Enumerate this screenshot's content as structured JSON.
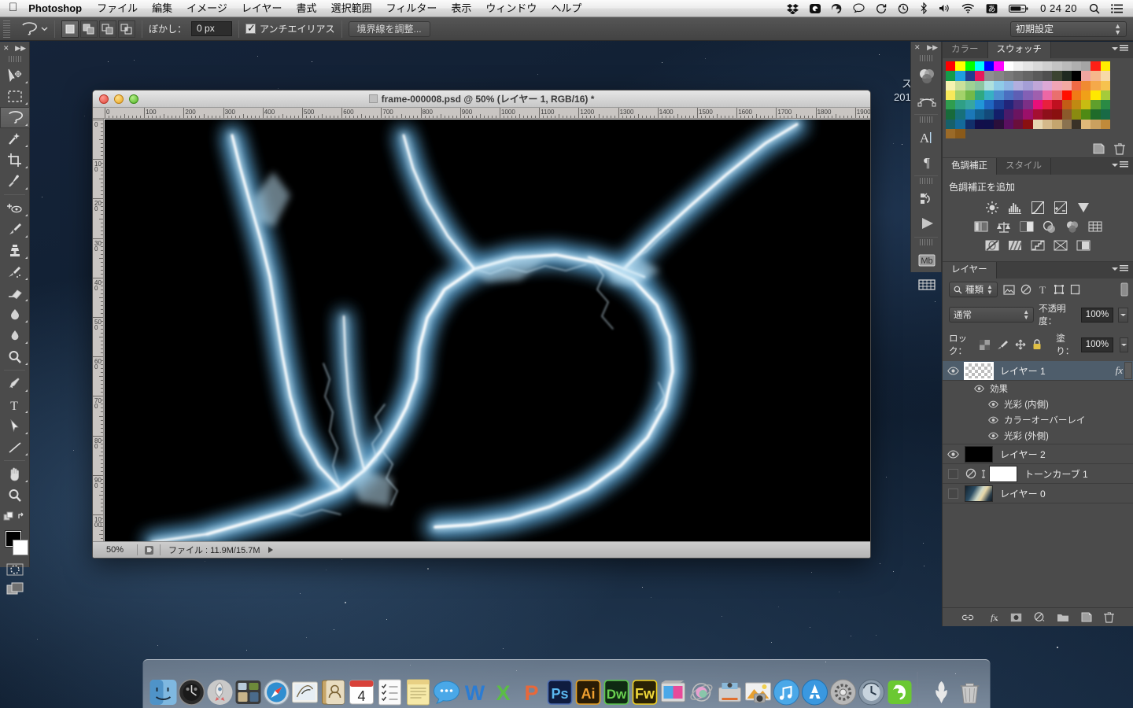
{
  "menubar": {
    "apple_icon": "apple-icon",
    "app_name": "Photoshop",
    "items": [
      "ファイル",
      "編集",
      "イメージ",
      "レイヤー",
      "書式",
      "選択範囲",
      "フィルター",
      "表示",
      "ウィンドウ",
      "ヘルプ"
    ],
    "status_icons": [
      "dropbox-icon",
      "quicksilver-icon",
      "evernote-icon",
      "chat-bubble-icon",
      "sync-icon",
      "time-machine-icon",
      "bluetooth-icon",
      "volume-icon",
      "wifi-icon",
      "input-source-icon",
      "battery-icon"
    ],
    "input_source_label": "あ",
    "clock": "0 24 20",
    "search_icon": "search-icon",
    "notification_icon": "notification-list-icon"
  },
  "options_bar": {
    "tool_icon": "lasso-tool-icon",
    "tool_preset_arrow": "chevron-down-icon",
    "selection_modes": [
      "new-selection-icon",
      "add-to-selection-icon",
      "subtract-from-selection-icon",
      "intersect-selection-icon"
    ],
    "feather_label": "ぼかし：",
    "feather_value": "0 px",
    "antialias_label": "アンチエイリアス",
    "antialias_checked": true,
    "refine_edge_label": "境界線を調整...",
    "workspace_value": "初期設定"
  },
  "toolbar": {
    "collapse_icon": "collapse-icon",
    "expand_icon": "expand-arrows-icon",
    "tools": [
      {
        "name": "move-tool",
        "active": false
      },
      {
        "name": "marquee-tool",
        "active": false
      },
      {
        "name": "lasso-tool",
        "active": true
      },
      {
        "name": "magic-wand-tool",
        "active": false
      },
      {
        "name": "crop-tool",
        "active": false
      },
      {
        "name": "eyedropper-tool",
        "active": false
      },
      {
        "name": "spot-healing-tool",
        "active": false
      },
      {
        "name": "brush-tool",
        "active": false
      },
      {
        "name": "clone-stamp-tool",
        "active": false
      },
      {
        "name": "history-brush-tool",
        "active": false
      },
      {
        "name": "eraser-tool",
        "active": false
      },
      {
        "name": "gradient-tool",
        "active": false
      },
      {
        "name": "blur-tool",
        "active": false
      },
      {
        "name": "dodge-tool",
        "active": false
      },
      {
        "name": "pen-tool",
        "active": false
      },
      {
        "name": "type-tool",
        "active": false
      },
      {
        "name": "path-selection-tool",
        "active": false
      },
      {
        "name": "line-shape-tool",
        "active": false
      },
      {
        "name": "hand-tool",
        "active": false
      },
      {
        "name": "zoom-tool",
        "active": false
      }
    ],
    "foreground_color": "#000000",
    "background_color": "#ffffff",
    "quick_mask_icon": "quick-mask-icon",
    "screen_mode_icon": "screen-mode-icon"
  },
  "document": {
    "title": "frame-000008.psd @ 50% (レイヤー 1, RGB/16) *",
    "zoom": "50%",
    "file_info_label": "ファイル : 11.9M/15.7M",
    "ruler_h_ticks": [
      "0",
      "100",
      "200",
      "300",
      "400",
      "500",
      "600",
      "700",
      "800",
      "900",
      "1000",
      "1100",
      "1200",
      "1300",
      "1400",
      "1500",
      "1600",
      "1700",
      "1800",
      "1900"
    ],
    "ruler_v_ticks": [
      "0",
      "100",
      "200",
      "300",
      "400",
      "500",
      "600",
      "700",
      "800",
      "900",
      "1000"
    ],
    "canvas_background": "#000000",
    "artwork_description": "glowing blue-white lightning arc forming a circular loop with branches"
  },
  "mini_dock": {
    "icons": [
      "color-wheel-icon",
      "paths-icon",
      "character-icon",
      "paragraph-icon",
      "history-icon",
      "animation-play-icon",
      "measurement-log-icon",
      "timeline-icon"
    ],
    "character_glyph": "A",
    "paragraph_glyph": "¶",
    "measurement_glyph": "Mb"
  },
  "color_panel": {
    "tabs": [
      {
        "label": "カラー",
        "active": false
      },
      {
        "label": "スウォッチ",
        "active": true
      }
    ],
    "swatch_colors": [
      "#ff0000",
      "#ffff00",
      "#00ff00",
      "#00ffff",
      "#0000ff",
      "#ff00ff",
      "#ffffff",
      "#efefef",
      "#e4e4e4",
      "#d9d9d9",
      "#cfcfcf",
      "#c4c4c4",
      "#bababa",
      "#afafaf",
      "#a5a5a5",
      "#ff2016",
      "#ffec00",
      "#159b4a",
      "#1e9fe0",
      "#243d8f",
      "#e8175d",
      "#8f8f8f",
      "#858585",
      "#7a7a7a",
      "#6f6f6f",
      "#656565",
      "#5a5a5a",
      "#4f4f4f",
      "#3c4431",
      "#1f2a20",
      "#000000",
      "#f0a6a0",
      "#f5b78c",
      "#f7d9a8",
      "#f6f2b0",
      "#cbe09a",
      "#9fd193",
      "#8cc5a0",
      "#aee0dd",
      "#8ecbe8",
      "#8fb6e4",
      "#b2aede",
      "#a49ed6",
      "#c0a6d8",
      "#dda8d6",
      "#f1a5b5",
      "#f3a9a2",
      "#ef6a45",
      "#f08a32",
      "#f5a94a",
      "#f6c24f",
      "#f7e95a",
      "#a3d26a",
      "#73b949",
      "#2fa882",
      "#37b0c4",
      "#4d8fd0",
      "#4b6fc0",
      "#5e5fb4",
      "#8360b5",
      "#9f5fae",
      "#ec67a5",
      "#e96f6e",
      "#ff0f00",
      "#f07b16",
      "#f0a018",
      "#ffe800",
      "#a5cb3a",
      "#2f9d4e",
      "#2f9f86",
      "#37a6a0",
      "#2196d8",
      "#1f66c0",
      "#1c3f96",
      "#22257a",
      "#4c2b7c",
      "#7c2f86",
      "#e8107a",
      "#e8203d",
      "#c01020",
      "#c35d16",
      "#c08a12",
      "#c7bc12",
      "#5f9f2c",
      "#2a8a44",
      "#186a3a",
      "#17707a",
      "#1b78b8",
      "#13608f",
      "#134a7a",
      "#131f6a",
      "#4a1b6a",
      "#6b1460",
      "#9b106a",
      "#a40f31",
      "#8e0f1b",
      "#8a1010",
      "#8b5a2b",
      "#8a8a10",
      "#4f8a14",
      "#1f6b2a",
      "#186a46",
      "#17606a",
      "#146a9a",
      "#122f6a",
      "#120f4a",
      "#10104a",
      "#2b0f3a",
      "#5a1060",
      "#6a0f3a",
      "#8a1010",
      "#e6d6b0",
      "#d4b98a",
      "#c4a56e",
      "#8a7250",
      "#3a3228",
      "#e0b879",
      "#caa05f",
      "#c08a3a",
      "#9a6a28",
      "#8a5a1a",
      "",
      "",
      "",
      ""
    ],
    "footer_icons": [
      "new-swatch-icon",
      "delete-swatch-icon"
    ]
  },
  "adjustments_panel": {
    "tabs": [
      {
        "label": "色調補正",
        "active": true
      },
      {
        "label": "スタイル",
        "active": false
      }
    ],
    "title": "色調補正を追加",
    "rows": [
      [
        "brightness-contrast-icon",
        "levels-icon",
        "curves-icon",
        "exposure-icon",
        "vibrance-icon"
      ],
      [
        "hue-saturation-icon",
        "color-balance-icon",
        "black-white-icon",
        "photo-filter-icon",
        "channel-mixer-icon",
        "color-lookup-icon"
      ],
      [
        "invert-icon",
        "posterize-icon",
        "threshold-icon",
        "gradient-map-icon",
        "selective-color-icon"
      ]
    ]
  },
  "layers_panel": {
    "tab_label": "レイヤー",
    "filter_label": "種類",
    "filter_icons": [
      "filter-pixel-icon",
      "filter-adjustment-icon",
      "filter-type-icon",
      "filter-shape-icon",
      "filter-smart-icon"
    ],
    "blend_mode": "通常",
    "opacity_label": "不透明度：",
    "opacity_value": "100%",
    "lock_label": "ロック：",
    "lock_icons": [
      "lock-transparency-icon",
      "lock-image-icon",
      "lock-position-icon",
      "lock-all-icon"
    ],
    "fill_label": "塗り：",
    "fill_value": "100%",
    "layers": [
      {
        "name": "レイヤー 1",
        "visible": true,
        "selected": true,
        "has_fx": true,
        "fx_label": "fx",
        "thumb": "transparent-checker"
      },
      {
        "name": "効果",
        "visible": true,
        "type": "effects-group",
        "indent": 1
      },
      {
        "name": "光彩 (内側)",
        "visible": true,
        "type": "effect",
        "indent": 2
      },
      {
        "name": "カラーオーバーレイ",
        "visible": true,
        "type": "effect",
        "indent": 2
      },
      {
        "name": "光彩 (外側)",
        "visible": true,
        "type": "effect",
        "indent": 2
      },
      {
        "name": "レイヤー 2",
        "visible": true,
        "selected": false,
        "thumb": "#000000"
      },
      {
        "name": "トーンカーブ 1",
        "visible": false,
        "selected": false,
        "thumb": "#ffffff",
        "type": "adjustment"
      },
      {
        "name": "レイヤー 0",
        "visible": false,
        "selected": false,
        "thumb": "image"
      }
    ],
    "footer_icons": [
      "link-layers-icon",
      "add-layer-style-icon",
      "add-layer-mask-icon",
      "new-adjustment-icon",
      "new-group-icon",
      "new-layer-icon",
      "delete-layer-icon"
    ]
  },
  "desktop": {
    "partial_text_1": "ス",
    "partial_text_2": "201"
  },
  "dock": {
    "items": [
      {
        "name": "finder",
        "color": "#4b9ad4"
      },
      {
        "name": "dashboard",
        "color": "#2b2b2b"
      },
      {
        "name": "launchpad",
        "color": "#bdbdbd"
      },
      {
        "name": "mission-control",
        "color": "#3a3a3a"
      },
      {
        "name": "safari",
        "color": "#2d8fd4"
      },
      {
        "name": "mail",
        "color": "#e8e8e8"
      },
      {
        "name": "contacts",
        "color": "#b89a63"
      },
      {
        "name": "calendar",
        "color": "#ffffff",
        "badge": "4"
      },
      {
        "name": "reminders",
        "color": "#f2f2f2"
      },
      {
        "name": "notes",
        "color": "#f5e6a8"
      },
      {
        "name": "messages",
        "color": "#3aa0e8"
      },
      {
        "name": "word",
        "color": "#2b7cd3"
      },
      {
        "name": "excel",
        "color": "#5bbd45"
      },
      {
        "name": "powerpoint",
        "color": "#e8683a"
      },
      {
        "name": "photoshop",
        "color": "#2b3a6b"
      },
      {
        "name": "illustrator",
        "color": "#3a2b10"
      },
      {
        "name": "dreamweaver",
        "color": "#1e3a1e"
      },
      {
        "name": "fireworks",
        "color": "#3a2a10"
      },
      {
        "name": "final-cut-pro",
        "color": "#cfcfcf"
      },
      {
        "name": "motion",
        "color": "#dddddd"
      },
      {
        "name": "compressor",
        "color": "#cccccc"
      },
      {
        "name": "iphoto",
        "color": "#d8d8d8"
      },
      {
        "name": "itunes",
        "color": "#3a9fe0"
      },
      {
        "name": "app-store",
        "color": "#2b8fd8"
      },
      {
        "name": "system-preferences",
        "color": "#9a9a9a"
      },
      {
        "name": "time-machine",
        "color": "#7a8a9a"
      },
      {
        "name": "evernote",
        "color": "#67c93a"
      },
      {
        "name": "downloads-stack",
        "color": "#dddddd"
      },
      {
        "name": "trash",
        "color": "#bbbbbb"
      }
    ]
  }
}
